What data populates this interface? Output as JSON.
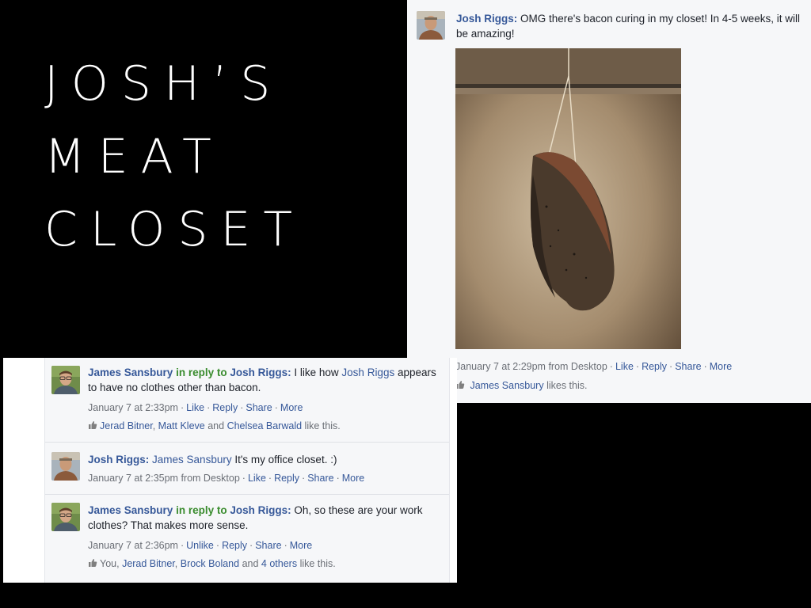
{
  "slide": {
    "title_lines": [
      "JOSH’S",
      "MEAT",
      "CLOSET"
    ]
  },
  "top_post": {
    "author": "Josh Riggs",
    "text": "OMG there's bacon curing in my closet! In 4-5 weeks, it will be amazing!",
    "photo_subject": "bacon-hanging-photo",
    "timestamp": "January 7 at 2:29pm",
    "via": "from Desktop",
    "actions": [
      "Like",
      "Share",
      "More"
    ],
    "reply_label": "Reply",
    "likes_names": [
      "James Sansbury"
    ],
    "likes_suffix": "likes this."
  },
  "comments": [
    {
      "author": "James Sansbury",
      "reply_connector": "in reply to",
      "reply_target": "Josh Riggs",
      "text_prefix": "I like how ",
      "text_mention": "Josh Riggs",
      "text_suffix": " appears to have no clothes other than bacon.",
      "timestamp": "January 7 at 2:33pm",
      "actions": [
        "Like",
        "Reply",
        "Share",
        "More"
      ],
      "likes_names": [
        "Jerad Bitner",
        "Matt Kleve",
        "Chelsea Barwald"
      ],
      "likes_joiner": "and",
      "likes_suffix": "like this."
    },
    {
      "author": "Josh Riggs",
      "mention": "James Sansbury",
      "text": " It's my office closet. :)",
      "timestamp": "January 7 at 2:35pm",
      "via": "from Desktop",
      "actions": [
        "Like",
        "Reply",
        "Share",
        "More"
      ]
    },
    {
      "author": "James Sansbury",
      "reply_connector": "in reply to",
      "reply_target": "Josh Riggs",
      "text": " Oh, so these are your work clothes? That makes more sense.",
      "timestamp": "January 7 at 2:36pm",
      "actions": [
        "Unlike",
        "Reply",
        "Share",
        "More"
      ],
      "likes_you": "You,",
      "likes_names": [
        "Jerad Bitner",
        "Brock Boland"
      ],
      "likes_joiner": "and",
      "likes_others": "4 others",
      "likes_suffix": "like this."
    }
  ],
  "colors": {
    "background": "#000000",
    "card": "#f6f7f9",
    "link": "#365899",
    "reply_green": "#3a8c2e",
    "meta_grey": "#6b6f76"
  }
}
